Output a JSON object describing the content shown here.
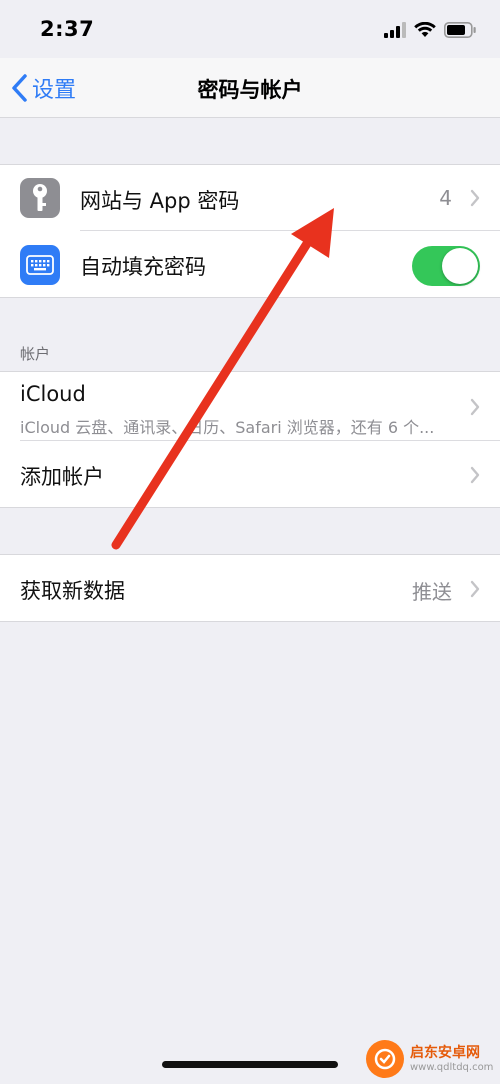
{
  "status_bar": {
    "time": "2:37",
    "icons": [
      "cellular-signal-icon",
      "wifi-icon",
      "battery-icon"
    ]
  },
  "nav": {
    "back_label": "设置",
    "title": "密码与帐户"
  },
  "passwords_group": {
    "website_passwords": {
      "label": "网站与 App 密码",
      "value": "4",
      "icon": "key-icon",
      "icon_color": "#8e8e93"
    },
    "autofill": {
      "label": "自动填充密码",
      "icon": "keyboard-icon",
      "icon_color": "#2f7cf6",
      "toggle_on": true,
      "toggle_color": "#34c759"
    }
  },
  "accounts_section": {
    "header": "帐户",
    "icloud": {
      "label": "iCloud",
      "subtitle": "iCloud 云盘、通讯录、日历、Safari 浏览器，还有 6 个..."
    },
    "add_account": {
      "label": "添加帐户"
    }
  },
  "fetch_group": {
    "fetch_new_data": {
      "label": "获取新数据",
      "value": "推送"
    }
  },
  "watermark": {
    "name": "启东安卓网",
    "url": "www.qdltdq.com"
  },
  "colors": {
    "accent": "#2f7cf6",
    "arrow": "#e8321e",
    "background": "#efeff4"
  }
}
